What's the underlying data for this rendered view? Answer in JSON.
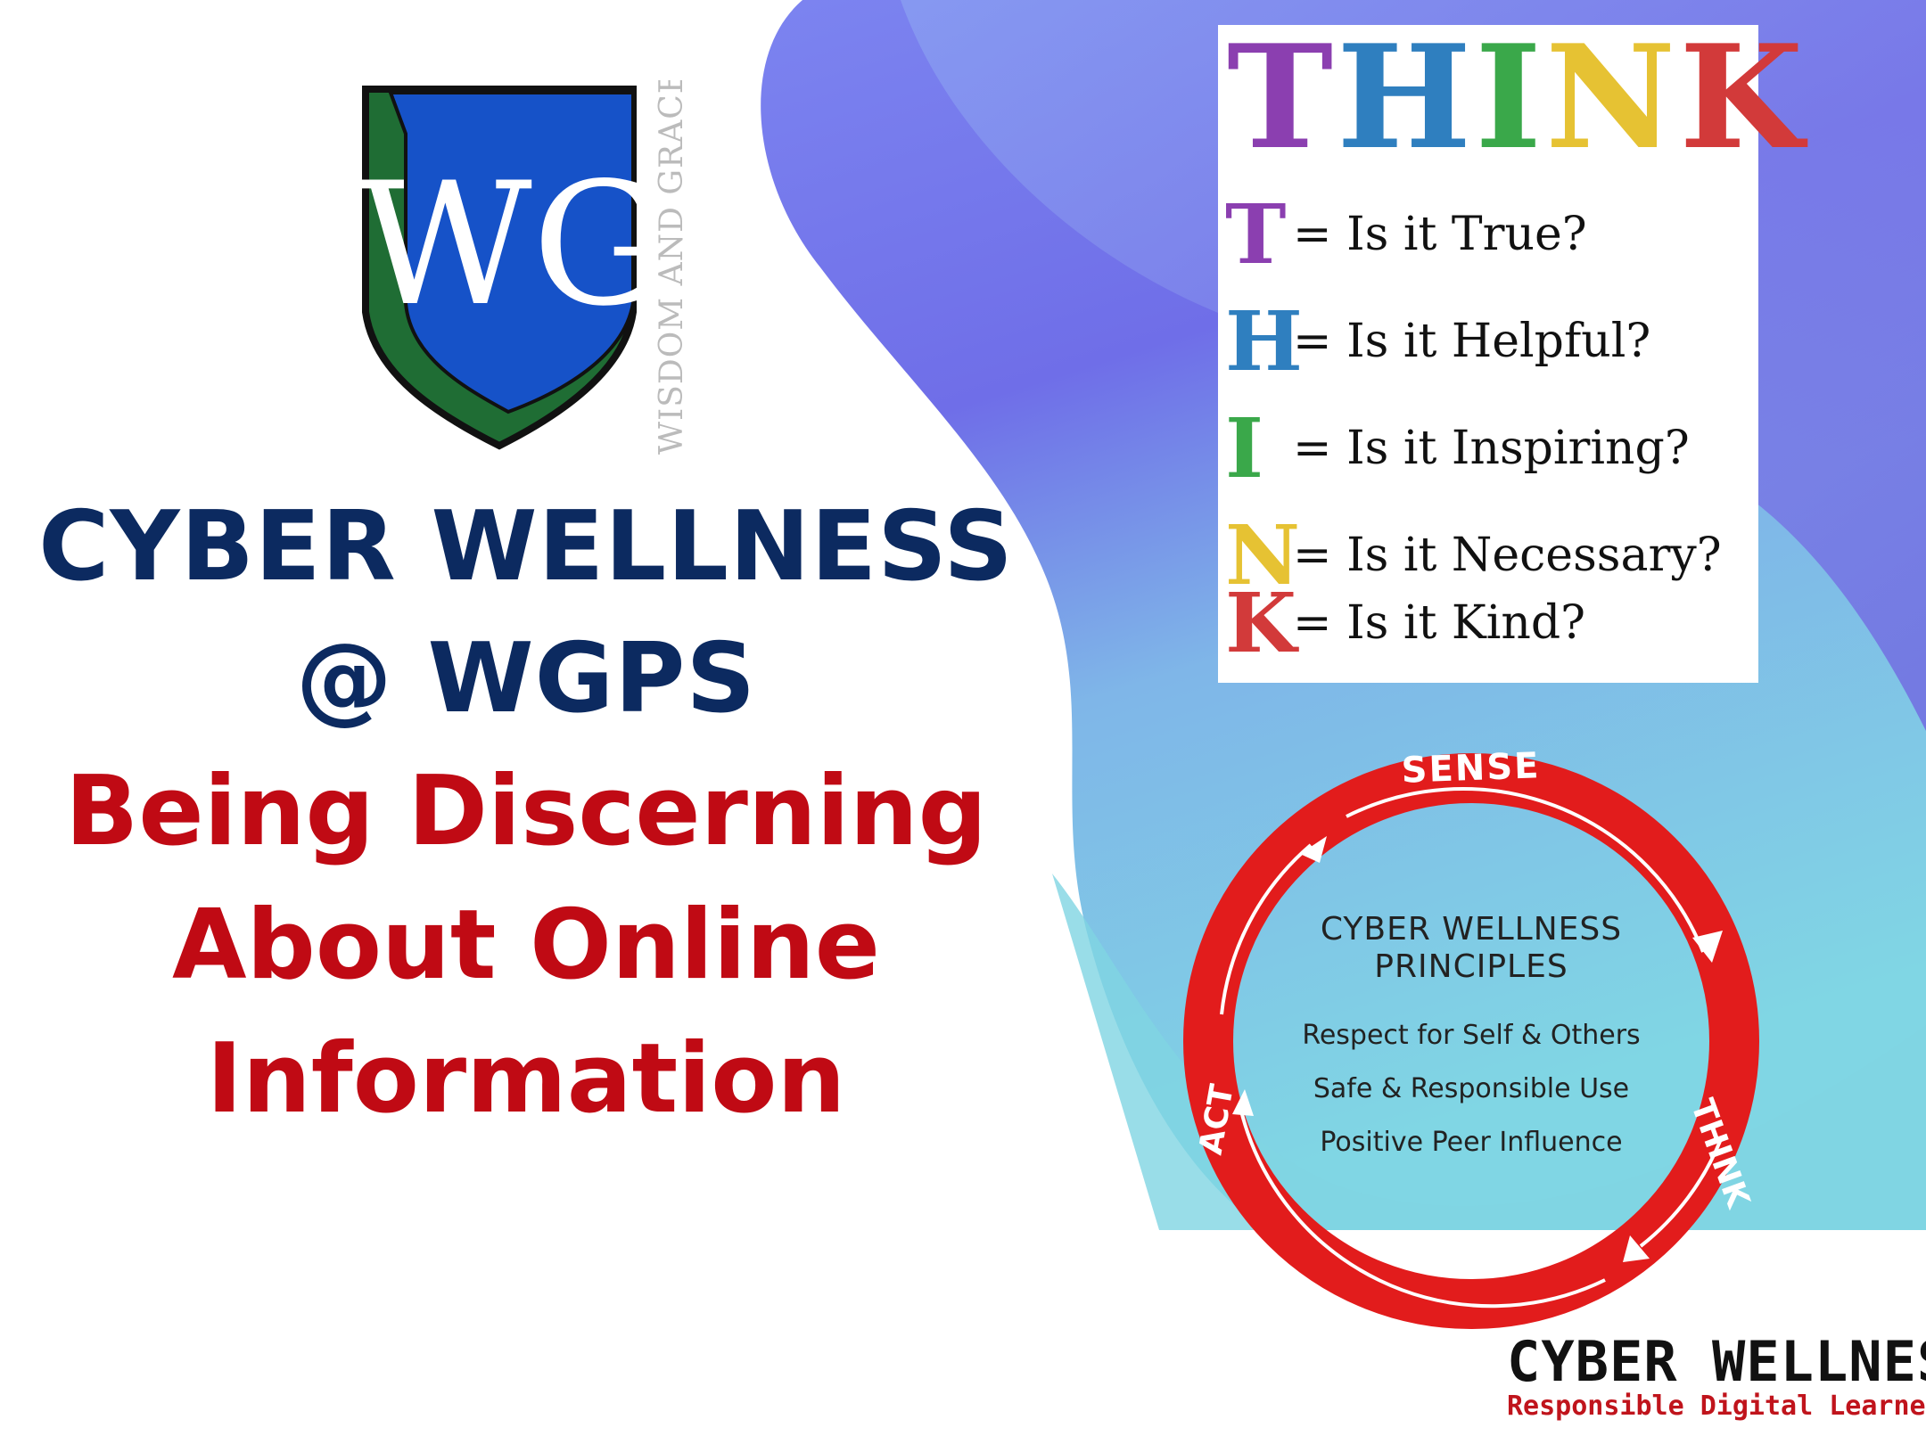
{
  "colors": {
    "navy": "#0c2a60",
    "red": "#c00a14",
    "crest_blue": "#1652c8",
    "crest_green": "#1f6d34",
    "blob_purple": "#6f6ee8",
    "blob_cyan": "#80d6e4",
    "ring_red": "#e21c1c"
  },
  "crest": {
    "monogram": "WG",
    "motto": "WISDOM AND GRACE"
  },
  "title": {
    "line1": "CYBER WELLNESS",
    "line2": "@ WGPS",
    "subtitle_line1": "Being Discerning",
    "subtitle_line2": "About Online",
    "subtitle_line3": "Information"
  },
  "think": {
    "heading_letters": [
      {
        "ch": "T",
        "color": "#8b3fb0"
      },
      {
        "ch": "H",
        "color": "#2f7fbf"
      },
      {
        "ch": "I",
        "color": "#3aa84a"
      },
      {
        "ch": "N",
        "color": "#e6c233"
      },
      {
        "ch": "K",
        "color": "#d23a3a"
      }
    ],
    "items": [
      {
        "letter": "T",
        "color": "#8b3fb0",
        "question": "= Is it True?"
      },
      {
        "letter": "H",
        "color": "#2f7fbf",
        "question": "= Is it Helpful?"
      },
      {
        "letter": "I",
        "color": "#3aa84a",
        "question": "= Is it Inspiring?"
      },
      {
        "letter": "N",
        "color": "#e6c233",
        "question": "= Is it Necessary?"
      },
      {
        "letter": "K",
        "color": "#d23a3a",
        "question": "= Is it Kind?"
      }
    ]
  },
  "principles": {
    "ring_labels": {
      "top": "SENSE",
      "right": "THINK",
      "left": "ACT"
    },
    "title_line1": "CYBER WELLNESS",
    "title_line2": "PRINCIPLES",
    "items": [
      "Respect for Self & Others",
      "Safe & Responsible Use",
      "Positive Peer Influence"
    ]
  },
  "logo": {
    "main": "CYBER WELLNESS",
    "tagline": "Responsible Digital Learners"
  }
}
